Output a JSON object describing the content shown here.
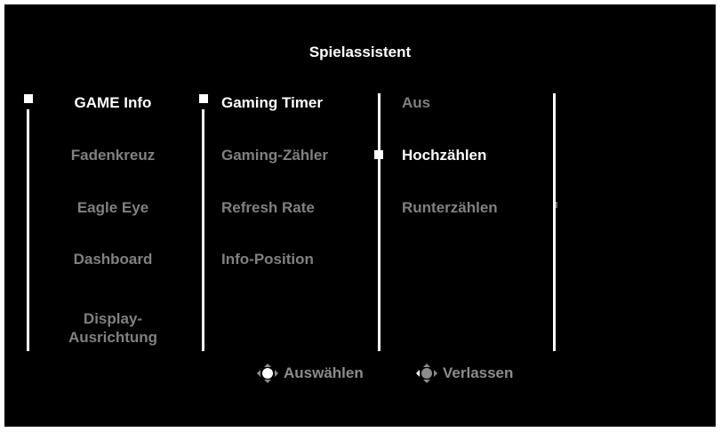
{
  "header": {
    "title": "Spielassistent"
  },
  "menu_main": {
    "items": [
      {
        "label": "GAME Info",
        "active": true
      },
      {
        "label": "Fadenkreuz",
        "active": false
      },
      {
        "label": "Eagle Eye",
        "active": false
      },
      {
        "label": "Dashboard",
        "active": false
      },
      {
        "label_line1": "Display-",
        "label_line2": "Ausrichtung",
        "active": false
      }
    ]
  },
  "menu_sub": {
    "items": [
      {
        "label": "Gaming Timer",
        "active": true
      },
      {
        "label": "Gaming-Zähler",
        "active": false
      },
      {
        "label": "Refresh Rate",
        "active": false
      },
      {
        "label": "Info-Position",
        "active": false
      }
    ]
  },
  "menu_options": {
    "items": [
      {
        "label": "Aus",
        "selected": false
      },
      {
        "label": "Hochzählen",
        "selected": true
      },
      {
        "label": "Runterzählen",
        "selected": false
      }
    ]
  },
  "footer": {
    "select_label": "Auswählen",
    "select_icon": "joystick-icon",
    "exit_label": "Verlassen",
    "exit_icon": "joystick-left-icon"
  },
  "colors": {
    "background": "#000000",
    "active_text": "#ffffff",
    "inactive_text": "#808080",
    "footer_text": "#8c8c8c"
  }
}
